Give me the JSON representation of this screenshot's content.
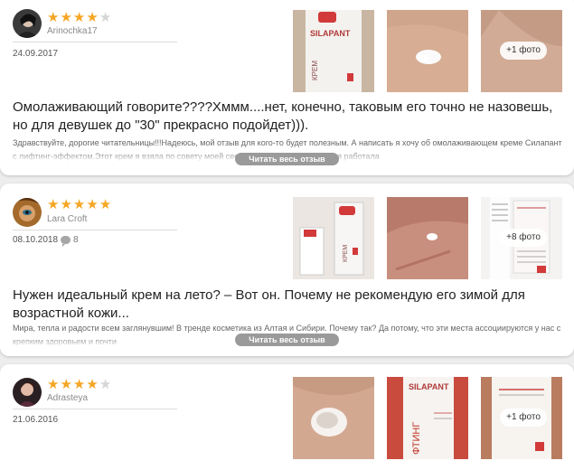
{
  "reviews": [
    {
      "author": "Arinochka17",
      "rating": 4,
      "date": "24.09.2017",
      "comments": "",
      "more_photos": "+1 фото",
      "title": "Омолаживающий говорите????Хммм....нет, конечно, таковым его точно не назовешь, но для девушек до \"30\" прекрасно подойдет))).",
      "excerpt": "Здравствуйте, дорогие читательницы!!!Надеюсь, мой отзыв для кого-то будет полезным. А написать я хочу об омолаживающем креме Силапант с лифтинг-эффектом.Этот крем я взяла по совету моей сестры-близняшки, она у меня работала",
      "read_more": "Читать весь отзыв",
      "product_label": "SILAPANT",
      "product_word": "КРЕМ"
    },
    {
      "author": "Lara Croft",
      "rating": 5,
      "date": "08.10.2018",
      "comments": "8",
      "more_photos": "+8 фото",
      "title": "Нужен идеальный крем на лето? – Вот он. Почему не рекомендую его зимой для возрастной кожи...",
      "excerpt": "Мира, тепла и радости всем заглянувшим! В тренде косметика из Алтая и Сибири. Почему так? Да потому, что эти места ассоциируются у нас с крепким здоровьем и почти",
      "read_more": "Читать весь отзыв",
      "product_word": "КРЕМ"
    },
    {
      "author": "Adrasteya",
      "rating": 4,
      "date": "21.06.2016",
      "comments": "",
      "more_photos": "+1 фото",
      "product_label": "SILAPANT",
      "product_word": "ФТИНГ"
    }
  ],
  "colors": {
    "star": "#f5a623",
    "star_off": "#d6d6d6",
    "button": "#9a9a9a"
  }
}
